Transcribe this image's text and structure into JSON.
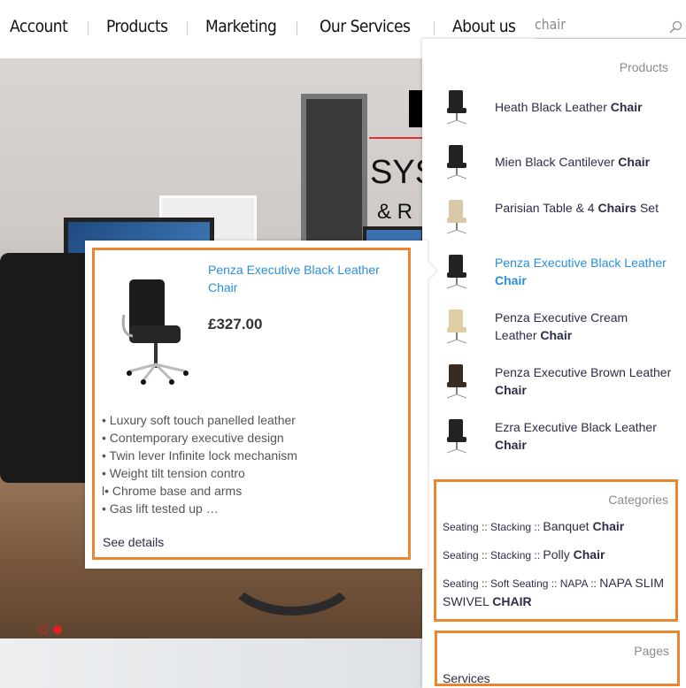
{
  "nav": {
    "items": [
      "Account",
      "Products",
      "Marketing",
      "Our Services",
      "About us"
    ]
  },
  "search": {
    "value": "chair",
    "icon": "search-icon"
  },
  "hero": {
    "title_line2": "SYS",
    "title_line3": "& R",
    "carousel_slides": 2,
    "active_slide": 2,
    "accent": "#dd3333"
  },
  "dropdown": {
    "products_title": "Products",
    "products": [
      {
        "pre": "Heath Black Leather ",
        "bold": "Chair",
        "post": ""
      },
      {
        "pre": "Mien Black Cantilever ",
        "bold": "Chair",
        "post": ""
      },
      {
        "pre": "Parisian Table & 4 ",
        "bold": "Chairs",
        "post": " Set"
      },
      {
        "pre": "Penza Executive Black Leather ",
        "bold": "Chair",
        "post": "",
        "active": true
      },
      {
        "pre": "Penza Executive Cream Leather ",
        "bold": "Chair",
        "post": ""
      },
      {
        "pre": "Penza Executive Brown Leather ",
        "bold": "Chair",
        "post": ""
      },
      {
        "pre": "Ezra Executive Black Leather ",
        "bold": "Chair",
        "post": ""
      }
    ],
    "categories_title": "Categories",
    "categories": [
      {
        "path": "Seating :: Stacking :: ",
        "pre": "Banquet ",
        "bold": "Chair"
      },
      {
        "path": "Seating :: Stacking :: ",
        "pre": "Polly ",
        "bold": "Chair"
      },
      {
        "path": "Seating :: Soft Seating :: NAPA :: ",
        "pre": "NAPA SLIM SWIVEL ",
        "bold": "CHAIR"
      }
    ],
    "pages_title": "Pages",
    "pages": [
      "Services"
    ]
  },
  "popup": {
    "name": "Penza Executive Black Leather Chair",
    "price": "£327.00",
    "bullets": [
      "• Luxury soft touch panelled leather",
      "• Contemporary executive design",
      "• Twin lever Infinite lock mechanism",
      "• Weight tilt tension contro",
      "l• Chrome base and arms",
      "• Gas lift tested up …"
    ],
    "see_details": "See details"
  },
  "colors": {
    "accent_orange": "#e8872f",
    "link_blue": "#2a8fd6",
    "text_navy": "#2d2d4a"
  }
}
